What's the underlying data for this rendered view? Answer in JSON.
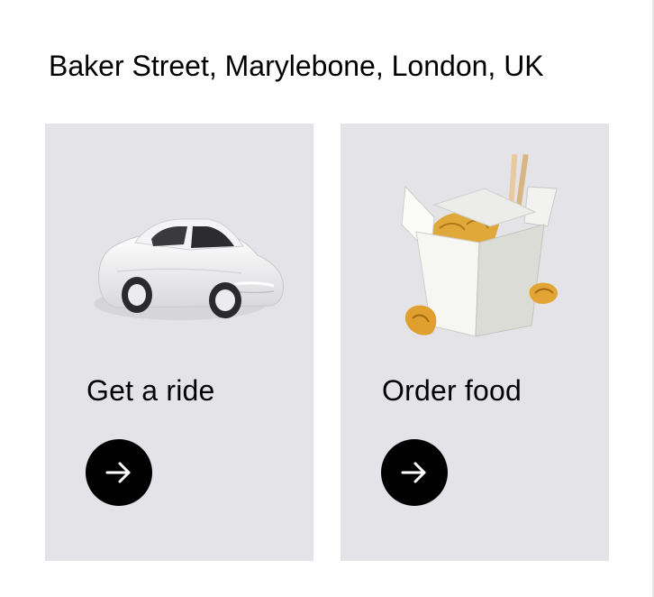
{
  "header": {
    "location": "Baker Street, Marylebone, London, UK"
  },
  "cards": [
    {
      "label": "Get a ride",
      "illustration": "car-illustration",
      "action_icon": "arrow-right-icon"
    },
    {
      "label": "Order food",
      "illustration": "takeout-box-illustration",
      "action_icon": "arrow-right-icon"
    }
  ],
  "colors": {
    "card_background": "#e4e4e8",
    "button_background": "#000000",
    "button_icon": "#ffffff",
    "text": "#000000"
  }
}
